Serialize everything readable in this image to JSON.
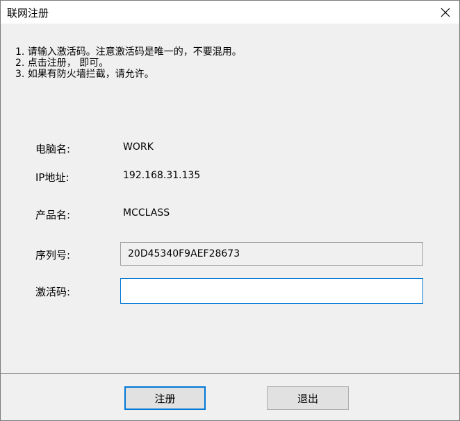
{
  "window": {
    "title": "联网注册",
    "close_label": "×"
  },
  "instructions": [
    "1. 请输入激活码。注意激活码是唯一的，不要混用。",
    "2. 点击注册， 即可。",
    "3. 如果有防火墙拦截，请允许。"
  ],
  "fields": {
    "computer_name": {
      "label": "电脑名:",
      "value": "WORK"
    },
    "ip_address": {
      "label": "IP地址:",
      "value": "192.168.31.135"
    },
    "product_name": {
      "label": "产品名:",
      "value": "MCCLASS"
    },
    "serial_number": {
      "label": "序列号:",
      "value": "20D45340F9AEF28673"
    },
    "activation_code": {
      "label": "激活码:",
      "value": ""
    }
  },
  "buttons": {
    "register": "注册",
    "exit": "退出"
  },
  "colors": {
    "focus": "#0078d7",
    "background": "#f0f0f0"
  }
}
